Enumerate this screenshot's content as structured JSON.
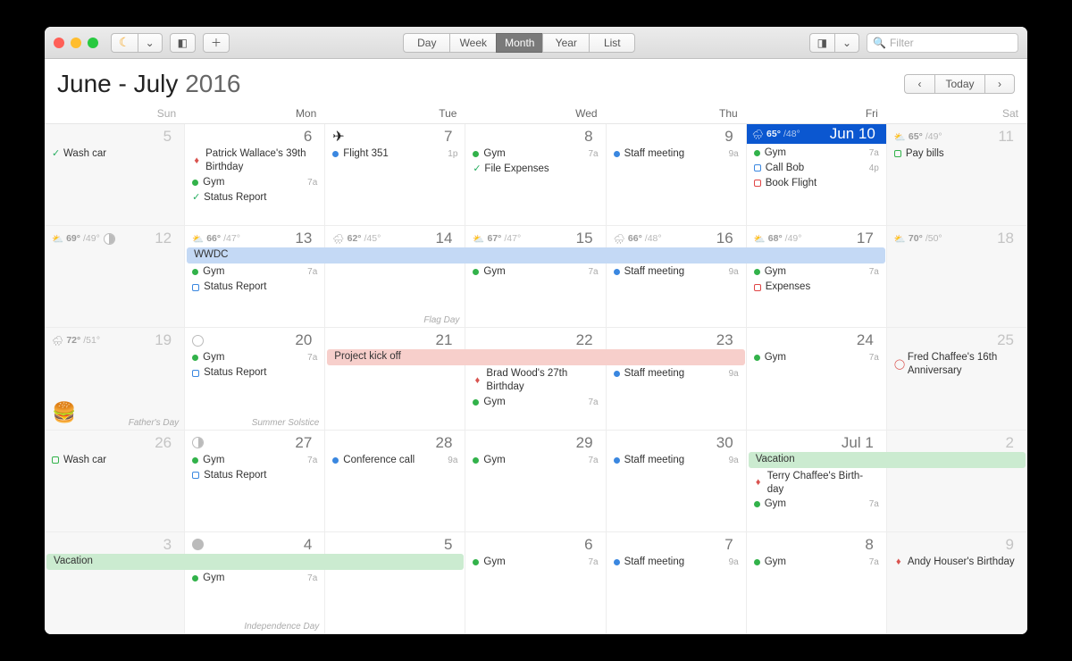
{
  "toolbar": {
    "views": [
      "Day",
      "Week",
      "Month",
      "Year",
      "List"
    ],
    "active_view": "Month",
    "search_placeholder": "Filter"
  },
  "header": {
    "title_bold": "June - July",
    "title_year": "2016",
    "today_label": "Today"
  },
  "dow": [
    "Sun",
    "Mon",
    "Tue",
    "Wed",
    "Thu",
    "Fri",
    "Sat"
  ],
  "banners": [
    {
      "label": "WWDC",
      "color": "#c4d9f5",
      "row": 1,
      "col_start": 1,
      "col_end": 6,
      "offset": 24
    },
    {
      "label": "Project kick off",
      "color": "#f7cfcb",
      "row": 2,
      "col_start": 2,
      "col_end": 5,
      "offset": 24
    },
    {
      "label": "Vacation",
      "color": "#cbebd0",
      "row": 3,
      "col_start": 5,
      "col_end": 7,
      "offset": 24
    },
    {
      "label": "Vacation",
      "color": "#cbebd0",
      "row": 4,
      "col_start": 0,
      "col_end": 3,
      "offset": 24
    }
  ],
  "weeks": [
    [
      {
        "num": "5",
        "we": true,
        "fade": true,
        "events": [
          {
            "icon": "ck",
            "label": "Wash car"
          }
        ]
      },
      {
        "num": "6",
        "events": [
          {
            "icon": "gift",
            "label": "Patrick Wallace's 39th Birthday"
          },
          {
            "icon": "dot green",
            "label": "Gym",
            "time": "7a"
          },
          {
            "icon": "ck",
            "label": "Status Report"
          }
        ]
      },
      {
        "num": "7",
        "plane": true,
        "events": [
          {
            "icon": "dot blue",
            "label": "Flight 351",
            "time": "1p"
          }
        ]
      },
      {
        "num": "8",
        "events": [
          {
            "icon": "dot green",
            "label": "Gym",
            "time": "7a"
          },
          {
            "icon": "ck",
            "label": "File Expenses"
          }
        ]
      },
      {
        "num": "9",
        "events": [
          {
            "icon": "dot blue",
            "label": "Staff meeting",
            "time": "9a"
          }
        ]
      },
      {
        "num": "Jun 10",
        "today": true,
        "weather": {
          "icon": "🌧",
          "hi": "65°",
          "lo": "/48°"
        },
        "events": [
          {
            "icon": "dot green",
            "label": "Gym",
            "time": "7a"
          },
          {
            "icon": "sq blue",
            "label": "Call Bob",
            "time": "4p"
          },
          {
            "icon": "sq red",
            "label": "Book Flight"
          }
        ]
      },
      {
        "num": "11",
        "we": true,
        "fade": true,
        "weather": {
          "icon": "⛅",
          "hi": "65°",
          "lo": "/49°"
        },
        "events": [
          {
            "icon": "sq green",
            "label": "Pay bills"
          }
        ]
      }
    ],
    [
      {
        "num": "12",
        "we": true,
        "fade": true,
        "weather": {
          "icon": "⛅",
          "hi": "69°",
          "lo": "/49°"
        },
        "moon": "q"
      },
      {
        "num": "13",
        "weather": {
          "icon": "⛅",
          "hi": "66°",
          "lo": "/47°"
        },
        "events": [
          {
            "pad": true
          },
          {
            "icon": "dot green",
            "label": "Gym",
            "time": "7a"
          },
          {
            "icon": "sq blue",
            "label": "Status Report"
          }
        ]
      },
      {
        "num": "14",
        "weather": {
          "icon": "🌧",
          "hi": "62°",
          "lo": "/45°"
        },
        "sub": "Flag Day"
      },
      {
        "num": "15",
        "weather": {
          "icon": "⛅",
          "hi": "67°",
          "lo": "/47°"
        },
        "events": [
          {
            "pad": true
          },
          {
            "icon": "dot green",
            "label": "Gym",
            "time": "7a"
          }
        ]
      },
      {
        "num": "16",
        "weather": {
          "icon": "🌧",
          "hi": "66°",
          "lo": "/48°"
        },
        "events": [
          {
            "pad": true
          },
          {
            "icon": "dot blue",
            "label": "Staff meeting",
            "time": "9a"
          }
        ]
      },
      {
        "num": "17",
        "weather": {
          "icon": "⛅",
          "hi": "68°",
          "lo": "/49°"
        },
        "events": [
          {
            "pad": true
          },
          {
            "icon": "dot green",
            "label": "Gym",
            "time": "7a"
          },
          {
            "icon": "sq red",
            "label": "Expenses"
          }
        ]
      },
      {
        "num": "18",
        "we": true,
        "fade": true,
        "weather": {
          "icon": "⛅",
          "hi": "70°",
          "lo": "/50°"
        }
      }
    ],
    [
      {
        "num": "19",
        "we": true,
        "fade": true,
        "weather": {
          "icon": "🌧",
          "hi": "72°",
          "lo": "/51°"
        },
        "sub": "Father's Day",
        "burger": true
      },
      {
        "num": "20",
        "moon": "full",
        "events": [
          {
            "icon": "dot green",
            "label": "Gym",
            "time": "7a"
          },
          {
            "icon": "sq blue",
            "label": "Status Report"
          }
        ],
        "sub": "Summer Solstice"
      },
      {
        "num": "21"
      },
      {
        "num": "22",
        "events": [
          {
            "pad": true
          },
          {
            "icon": "gift",
            "label": "Brad Wood's 27th Birthday"
          },
          {
            "icon": "dot green",
            "label": "Gym",
            "time": "7a"
          }
        ]
      },
      {
        "num": "23",
        "events": [
          {
            "pad": true
          },
          {
            "icon": "dot blue",
            "label": "Staff meeting",
            "time": "9a"
          }
        ]
      },
      {
        "num": "24",
        "events": [
          {
            "icon": "dot green",
            "label": "Gym",
            "time": "7a"
          }
        ]
      },
      {
        "num": "25",
        "we": true,
        "fade": true,
        "events": [
          {
            "icon": "ring",
            "label": "Fred Chaffee's 16th Anniversary"
          }
        ]
      }
    ],
    [
      {
        "num": "26",
        "we": true,
        "fade": true,
        "events": [
          {
            "icon": "sq green",
            "label": "Wash car"
          }
        ]
      },
      {
        "num": "27",
        "moon": "q",
        "events": [
          {
            "icon": "dot green",
            "label": "Gym",
            "time": "7a"
          },
          {
            "icon": "sq blue",
            "label": "Status Report"
          }
        ]
      },
      {
        "num": "28",
        "events": [
          {
            "icon": "dot blue",
            "label": "Conference call",
            "time": "9a"
          }
        ]
      },
      {
        "num": "29",
        "events": [
          {
            "icon": "dot green",
            "label": "Gym",
            "time": "7a"
          }
        ]
      },
      {
        "num": "30",
        "events": [
          {
            "icon": "dot blue",
            "label": "Staff meeting",
            "time": "9a"
          }
        ]
      },
      {
        "num": "Jul 1",
        "events": [
          {
            "pad": true
          },
          {
            "icon": "gift",
            "label": "Terry Chaffee's Birth-day"
          },
          {
            "icon": "dot green",
            "label": "Gym",
            "time": "7a"
          }
        ]
      },
      {
        "num": "2",
        "we": true,
        "fade": true
      }
    ],
    [
      {
        "num": "3",
        "we": true,
        "fade": true
      },
      {
        "num": "4",
        "moon": "n",
        "events": [
          {
            "pad": true
          },
          {
            "icon": "dot green",
            "label": "Gym",
            "time": "7a"
          }
        ],
        "sub": "Independence Day"
      },
      {
        "num": "5"
      },
      {
        "num": "6",
        "events": [
          {
            "icon": "dot green",
            "label": "Gym",
            "time": "7a"
          }
        ]
      },
      {
        "num": "7",
        "events": [
          {
            "icon": "dot blue",
            "label": "Staff meeting",
            "time": "9a"
          }
        ]
      },
      {
        "num": "8",
        "events": [
          {
            "icon": "dot green",
            "label": "Gym",
            "time": "7a"
          }
        ]
      },
      {
        "num": "9",
        "we": true,
        "fade": true,
        "events": [
          {
            "icon": "gift",
            "label": "Andy Houser's Birthday"
          }
        ]
      }
    ]
  ]
}
